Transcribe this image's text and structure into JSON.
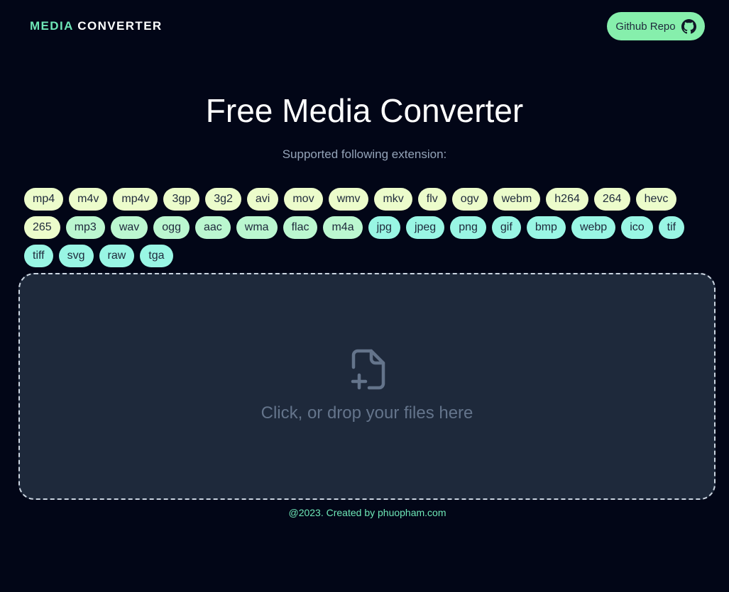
{
  "header": {
    "logo_accent": "MEDIA",
    "logo_rest": "CONVERTER",
    "github_label": "Github Repo",
    "github_icon": "github-icon"
  },
  "hero": {
    "title": "Free Media Converter",
    "subtitle": "Supported following extension:"
  },
  "extensions": {
    "video": [
      "mp4",
      "m4v",
      "mp4v",
      "3gp",
      "3g2",
      "avi",
      "mov",
      "wmv",
      "mkv",
      "flv",
      "ogv",
      "webm",
      "h264",
      "264",
      "hevc",
      "265"
    ],
    "audio": [
      "mp3",
      "wav",
      "ogg",
      "aac",
      "wma",
      "flac",
      "m4a"
    ],
    "image": [
      "jpg",
      "jpeg",
      "png",
      "gif",
      "bmp",
      "webp",
      "ico",
      "tif",
      "tiff",
      "svg",
      "raw",
      "tga"
    ]
  },
  "dropzone": {
    "text": "Click, or drop your files here",
    "icon": "file-plus-icon"
  },
  "footer": {
    "text": "@2023. Created by phuopham.com"
  },
  "colors": {
    "background": "#020617",
    "accent": "#6ee7b7",
    "github_button": "#86efac",
    "tag_video": "#ecfccb",
    "tag_audio": "#bbf7d0",
    "tag_image": "#99f6e4",
    "dropzone_bg": "#1e293b"
  }
}
